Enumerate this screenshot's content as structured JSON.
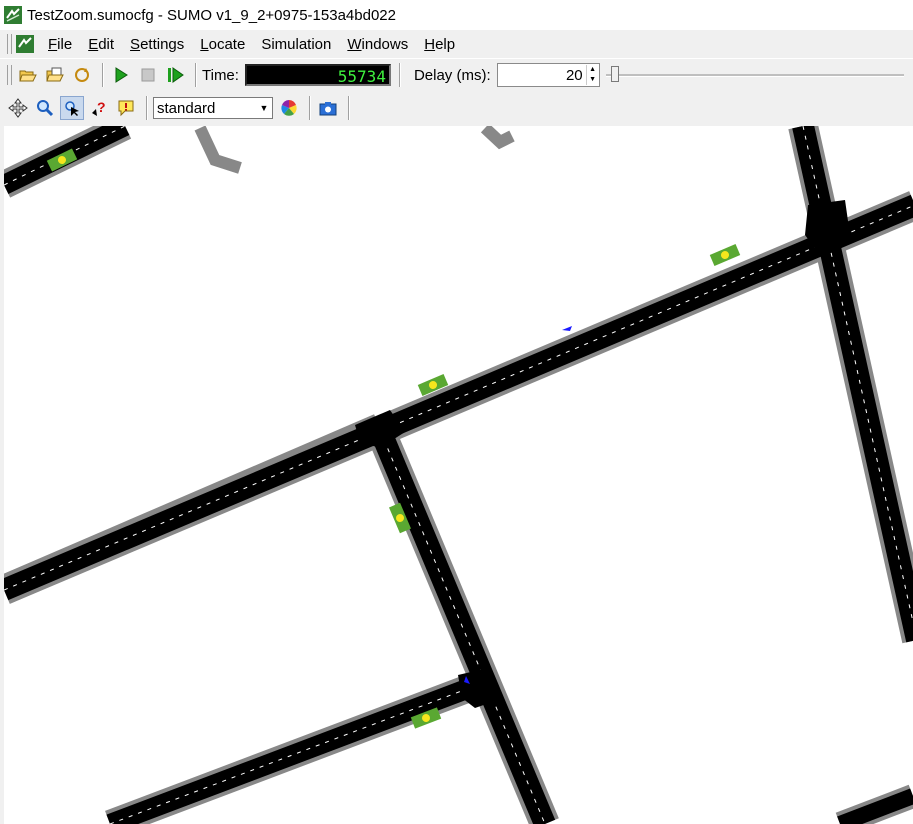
{
  "window": {
    "title": "TestZoom.sumocfg - SUMO v1_9_2+0975-153a4bd022",
    "icon": "sumo-app-icon"
  },
  "menu": {
    "items": [
      {
        "accel": "F",
        "rest": "ile"
      },
      {
        "accel": "E",
        "rest": "dit"
      },
      {
        "accel": "S",
        "rest": "ettings"
      },
      {
        "accel": "L",
        "rest": "ocate"
      },
      {
        "accel": "",
        "rest": "Simulation"
      },
      {
        "accel": "W",
        "rest": "indows"
      },
      {
        "accel": "H",
        "rest": "elp"
      }
    ]
  },
  "toolbar": {
    "open_icon": "open-config-icon",
    "reload_icon": "reload-icon",
    "time_label": "Time:",
    "time_value": "55734",
    "delay_label": "Delay (ms):",
    "delay_value": "20",
    "delay_slider_fraction": 0.02
  },
  "view_toolbar": {
    "scheme_selected": "standard",
    "icons": [
      "recenter-icon",
      "zoom-icon",
      "select-icon",
      "locate-icon",
      "warning-icon",
      "color-wheel-icon",
      "screenshot-icon"
    ]
  },
  "colors": {
    "lcd_text": "#3ef03e",
    "road": "#000000",
    "road_border": "#808080",
    "detector": "#5aa832",
    "vehicle": "#1a1aff"
  }
}
